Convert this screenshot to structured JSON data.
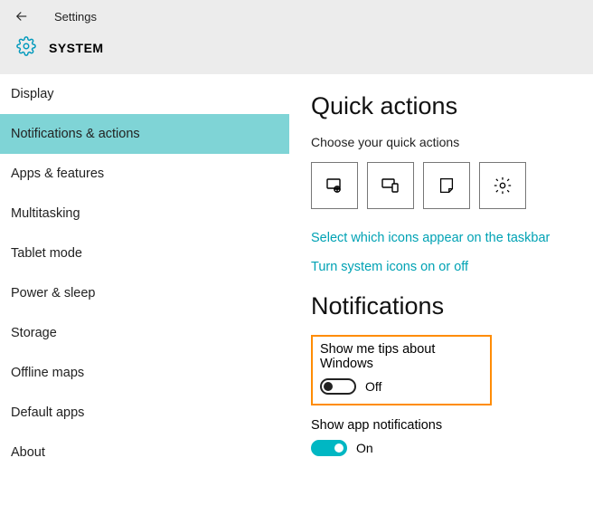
{
  "header": {
    "title": "Settings",
    "section": "SYSTEM"
  },
  "sidebar": {
    "items": [
      "Display",
      "Notifications & actions",
      "Apps & features",
      "Multitasking",
      "Tablet mode",
      "Power & sleep",
      "Storage",
      "Offline maps",
      "Default apps",
      "About"
    ],
    "active_index": 1
  },
  "content": {
    "quick_actions": {
      "heading": "Quick actions",
      "subtext": "Choose your quick actions",
      "tiles": [
        "tablet-mode-icon",
        "connect-icon",
        "note-icon",
        "settings-gear-icon"
      ],
      "link_taskbar": "Select which icons appear on the taskbar",
      "link_sysicons": "Turn system icons on or off"
    },
    "notifications": {
      "heading": "Notifications",
      "tips": {
        "label": "Show me tips about Windows",
        "state": "Off"
      },
      "app": {
        "label": "Show app notifications",
        "state": "On"
      }
    }
  }
}
